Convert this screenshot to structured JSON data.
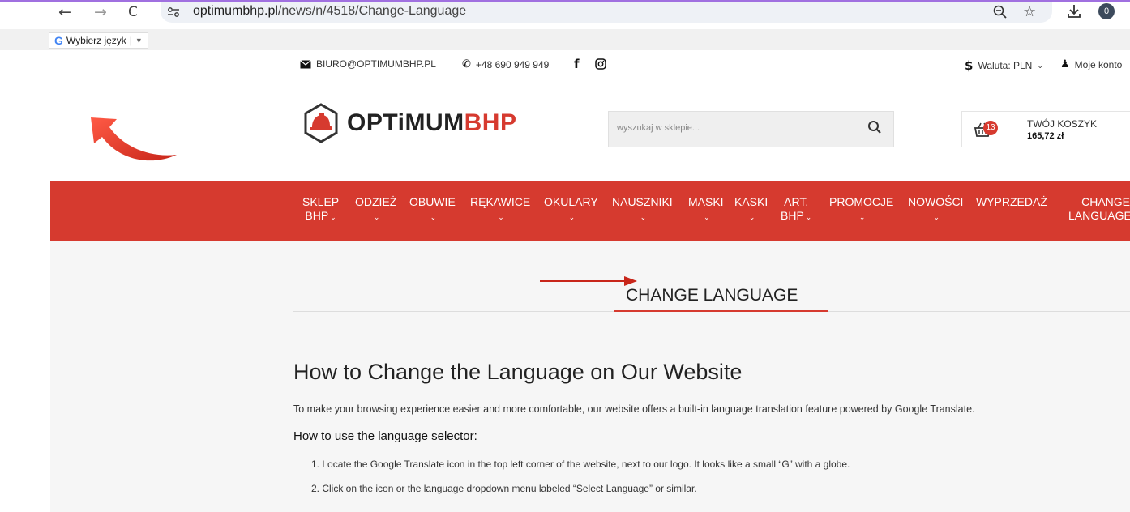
{
  "browser": {
    "back": "←",
    "forward": "→",
    "reload": "C",
    "url_domain": "optimumbhp.pl",
    "url_path": "/news/n/4518/Change-Language",
    "zoom_icon": "zoom-out-icon",
    "star_icon": "star-icon",
    "download_icon": "download-icon",
    "profile_badge": "0"
  },
  "translate_bar": {
    "g": "G",
    "label": "Wybierz język",
    "arrow": "▼"
  },
  "topline": {
    "email": "BIURO@OPTIMUMBHP.PL",
    "phone": "+48 690 949 949",
    "currency_label": "Waluta: PLN",
    "account_label": "Moje konto"
  },
  "logo": {
    "part1": "OPTiMUM",
    "part2": "BHP"
  },
  "search": {
    "placeholder": "wyszukaj w sklepie..."
  },
  "cart": {
    "badge": "13",
    "title": "TWÓJ KOSZYK",
    "amount": "165,72 zł"
  },
  "menu": [
    {
      "line1": "SKLEP",
      "line2": "BHP",
      "chevron": true
    },
    {
      "line1": "ODZIEŻ",
      "line2": "",
      "chevron": true
    },
    {
      "line1": "OBUWIE",
      "line2": "",
      "chevron": true
    },
    {
      "line1": "RĘKAWICE",
      "line2": "",
      "chevron": true
    },
    {
      "line1": "OKULARY",
      "line2": "",
      "chevron": true
    },
    {
      "line1": "NAUSZNIKI",
      "line2": "",
      "chevron": true
    },
    {
      "line1": "MASKI",
      "line2": "",
      "chevron": true
    },
    {
      "line1": "KASKI",
      "line2": "",
      "chevron": true
    },
    {
      "line1": "ART.",
      "line2": "BHP",
      "chevron": true
    },
    {
      "line1": "PROMOCJE",
      "line2": "",
      "chevron": true
    },
    {
      "line1": "NOWOŚCI",
      "line2": "",
      "chevron": true
    },
    {
      "line1": "WYPRZEDAŻ",
      "line2": "",
      "chevron": false
    },
    {
      "line1": "CHANGE",
      "line2": "LANGUAGE",
      "chevron": false
    }
  ],
  "content": {
    "section_title": "CHANGE LANGUAGE",
    "heading": "How to Change the Language on Our Website",
    "intro": "To make your browsing experience easier and more comfortable, our website offers a built-in language translation feature powered by Google Translate.",
    "subheading": "How to use the language selector:",
    "steps": [
      "1. Locate the Google Translate icon in the top left corner of the website, next to our logo. It looks like a small “G” with a globe.",
      "2. Click on the icon or the language dropdown menu labeled “Select Language” or similar."
    ]
  },
  "colors": {
    "brand_red": "#d63a2f",
    "content_bg": "#f6f6f6"
  }
}
